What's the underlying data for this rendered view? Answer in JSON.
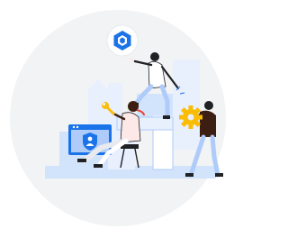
{
  "scene": {
    "kind": "illustration",
    "colors": {
      "background_circle": "#f1f3f4",
      "building": "#d2e3fc",
      "building_light": "#e8f0fe",
      "monitor_frame": "#1a73e8",
      "monitor_screen": "#aecbfa",
      "accent_blue": "#4285f4",
      "accent_yellow": "#fbbc04",
      "accent_red": "#ea4335",
      "outline_dark": "#202124",
      "skin_light": "#fce8e6",
      "skin_dark": "#3c1f12"
    },
    "icons": [
      "hexagon-settings-icon",
      "shield-person-icon",
      "gear-icon",
      "wrench-icon"
    ]
  }
}
